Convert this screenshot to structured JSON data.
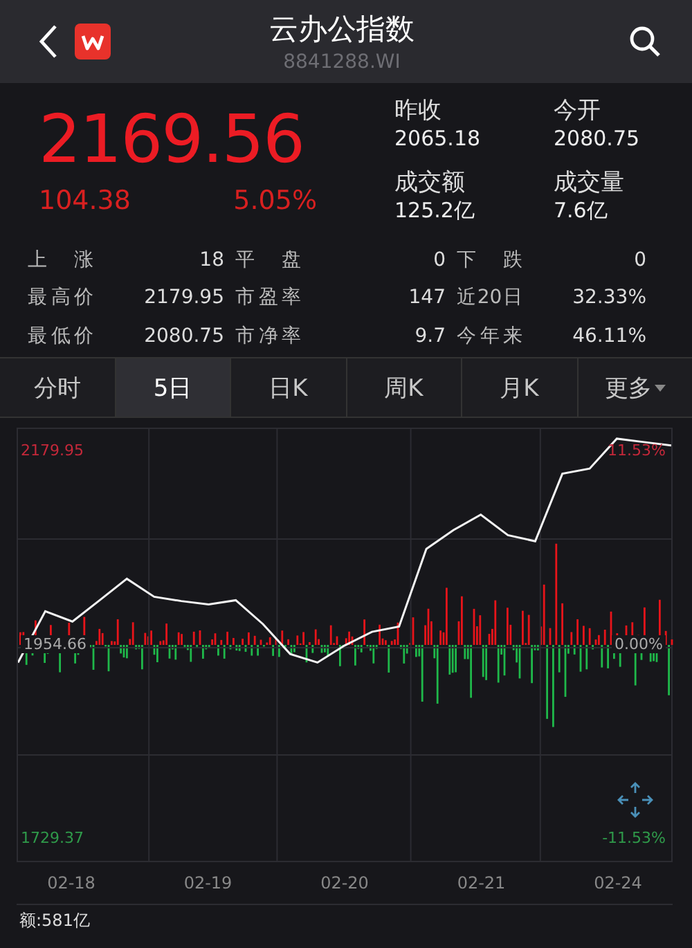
{
  "header": {
    "title": "云办公指数",
    "code": "8841288.WI"
  },
  "quote": {
    "price": "2169.56",
    "change": "104.38",
    "change_pct": "5.05%"
  },
  "summary": [
    {
      "label": "昨收",
      "value": "2065.18"
    },
    {
      "label": "今开",
      "value": "2080.75"
    },
    {
      "label": "成交额",
      "value": "125.2亿"
    },
    {
      "label": "成交量",
      "value": "7.6亿"
    }
  ],
  "stats": [
    {
      "label": "上涨",
      "value": "18"
    },
    {
      "label": "平盘",
      "value": "0"
    },
    {
      "label": "下跌",
      "value": "0"
    },
    {
      "label": "最高价",
      "value": "2179.95"
    },
    {
      "label": "市盈率",
      "value": "147"
    },
    {
      "label": "近20日",
      "value": "32.33%"
    },
    {
      "label": "最低价",
      "value": "2080.75"
    },
    {
      "label": "市净率",
      "value": "9.7"
    },
    {
      "label": "今年来",
      "value": "46.11%"
    }
  ],
  "tabs": [
    {
      "label": "分时",
      "selected": false,
      "kind": "period"
    },
    {
      "label": "5日",
      "selected": true,
      "kind": "period"
    },
    {
      "label": "日K",
      "selected": false,
      "kind": "period"
    },
    {
      "label": "周K",
      "selected": false,
      "kind": "period"
    },
    {
      "label": "月K",
      "selected": false,
      "kind": "period"
    },
    {
      "label": "更多",
      "selected": false,
      "kind": "menu"
    }
  ],
  "chart": {
    "pct_high": "11.53%",
    "pct_mid": "0.00%",
    "pct_low": "-11.53%",
    "chart_data": {
      "type": "line",
      "categories": [
        null,
        null,
        "02-18",
        null,
        null,
        null,
        null,
        "02-19",
        null,
        null,
        null,
        null,
        "02-20",
        null,
        null,
        null,
        null,
        "02-21",
        null,
        null,
        null,
        null,
        "02-24",
        null,
        null
      ],
      "series": [
        {
          "color": "#f4f4f4",
          "values": [
            1934,
            1994,
            1982,
            2007,
            2032,
            2011,
            2006,
            2002,
            2007,
            1979,
            1944,
            1934,
            1954,
            1970,
            1976,
            2067,
            2089,
            2107,
            2083,
            2076,
            2155,
            2161,
            2196,
            2192,
            2188
          ]
        }
      ],
      "ylim": [
        1702.0,
        2207.3
      ],
      "yticks": [
        {
          "value": 2179.95,
          "label": "2179.95"
        },
        {
          "value": 1954.66,
          "label": "1954.66"
        },
        {
          "value": 1729.37,
          "label": "1729.37"
        }
      ]
    }
  },
  "footer": {
    "amount": "额:581亿"
  }
}
